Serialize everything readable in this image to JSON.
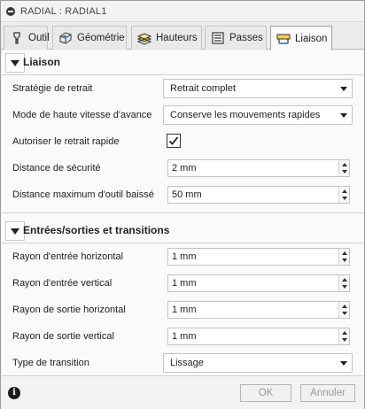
{
  "window": {
    "title": "RADIAL : RADIAL1"
  },
  "tabs": [
    {
      "label": "Outil",
      "icon": "tool-icon"
    },
    {
      "label": "Géométrie",
      "icon": "geometry-icon"
    },
    {
      "label": "Hauteurs",
      "icon": "heights-icon"
    },
    {
      "label": "Passes",
      "icon": "passes-icon"
    },
    {
      "label": "Liaison",
      "icon": "linking-icon",
      "active": true
    }
  ],
  "liaison": {
    "title": "Liaison",
    "rows": {
      "retract_strategy": {
        "label": "Stratégie de retrait",
        "value": "Retrait complet"
      },
      "high_feed_mode": {
        "label": "Mode de haute vitesse d'avance",
        "value": "Conserve les mouvements rapides"
      },
      "rapid_retract": {
        "label": "Autoriser le retrait rapide",
        "checked": true
      },
      "safe_distance": {
        "label": "Distance de sécurité",
        "value": "2 mm"
      },
      "max_stay_down": {
        "label": "Distance maximum d'outil baissé",
        "value": "50 mm"
      }
    }
  },
  "leads": {
    "title": "Entrées/sorties et transitions",
    "rows": {
      "entry_horizontal": {
        "label": "Rayon d'entrée horizontal",
        "value": "1 mm"
      },
      "entry_vertical": {
        "label": "Rayon d'entrée vertical",
        "value": "1 mm"
      },
      "exit_horizontal": {
        "label": "Rayon de sortie horizontal",
        "value": "1 mm"
      },
      "exit_vertical": {
        "label": "Rayon de sortie vertical",
        "value": "1 mm"
      },
      "transition_type": {
        "label": "Type de transition",
        "value": "Lissage"
      }
    }
  },
  "footer": {
    "ok_label": "OK",
    "cancel_label": "Annuler",
    "info_glyph": "i"
  },
  "colors": {
    "disabled_text": "#999999",
    "check": "#222222"
  }
}
